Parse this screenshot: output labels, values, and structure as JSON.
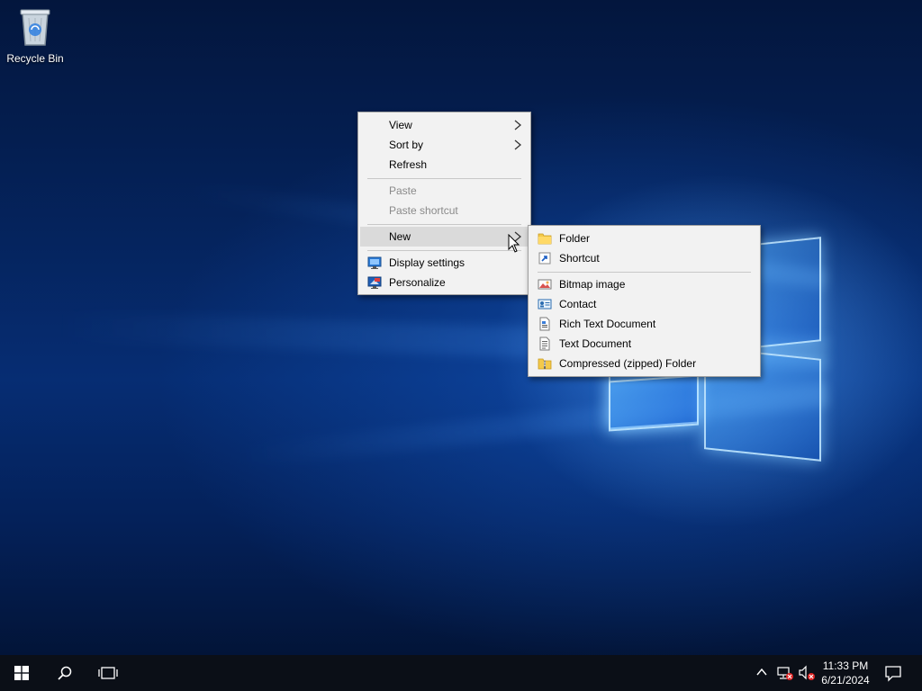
{
  "desktop": {
    "icons": [
      {
        "label": "Recycle Bin",
        "icon": "recycle-bin-icon"
      }
    ]
  },
  "context_menu": {
    "items": [
      {
        "label": "View",
        "has_submenu": true,
        "enabled": true
      },
      {
        "label": "Sort by",
        "has_submenu": true,
        "enabled": true
      },
      {
        "label": "Refresh",
        "enabled": true
      },
      {
        "label": "Paste",
        "enabled": false
      },
      {
        "label": "Paste shortcut",
        "enabled": false
      },
      {
        "label": "New",
        "has_submenu": true,
        "enabled": true,
        "highlighted": true
      },
      {
        "label": "Display settings",
        "icon": "display-settings-icon",
        "enabled": true
      },
      {
        "label": "Personalize",
        "icon": "personalize-icon",
        "enabled": true
      }
    ]
  },
  "new_submenu": {
    "items": [
      {
        "label": "Folder",
        "icon": "folder-icon"
      },
      {
        "label": "Shortcut",
        "icon": "shortcut-icon"
      },
      {
        "label": "Bitmap image",
        "icon": "bitmap-image-icon"
      },
      {
        "label": "Contact",
        "icon": "contact-icon"
      },
      {
        "label": "Rich Text Document",
        "icon": "rich-text-document-icon"
      },
      {
        "label": "Text Document",
        "icon": "text-document-icon"
      },
      {
        "label": "Compressed (zipped) Folder",
        "icon": "zipped-folder-icon"
      }
    ]
  },
  "taskbar": {
    "buttons": [
      "start-icon",
      "search-icon",
      "task-view-icon"
    ],
    "tray": [
      "chevron-up-icon",
      "network-icon",
      "volume-muted-icon"
    ],
    "clock": {
      "time": "11:33 PM",
      "date": "6/21/2024"
    }
  },
  "colors": {
    "menu_background": "#f2f2f2",
    "menu_highlight": "#dadada",
    "disabled_text": "#8a8a8a",
    "taskbar": "#0b0f17"
  }
}
